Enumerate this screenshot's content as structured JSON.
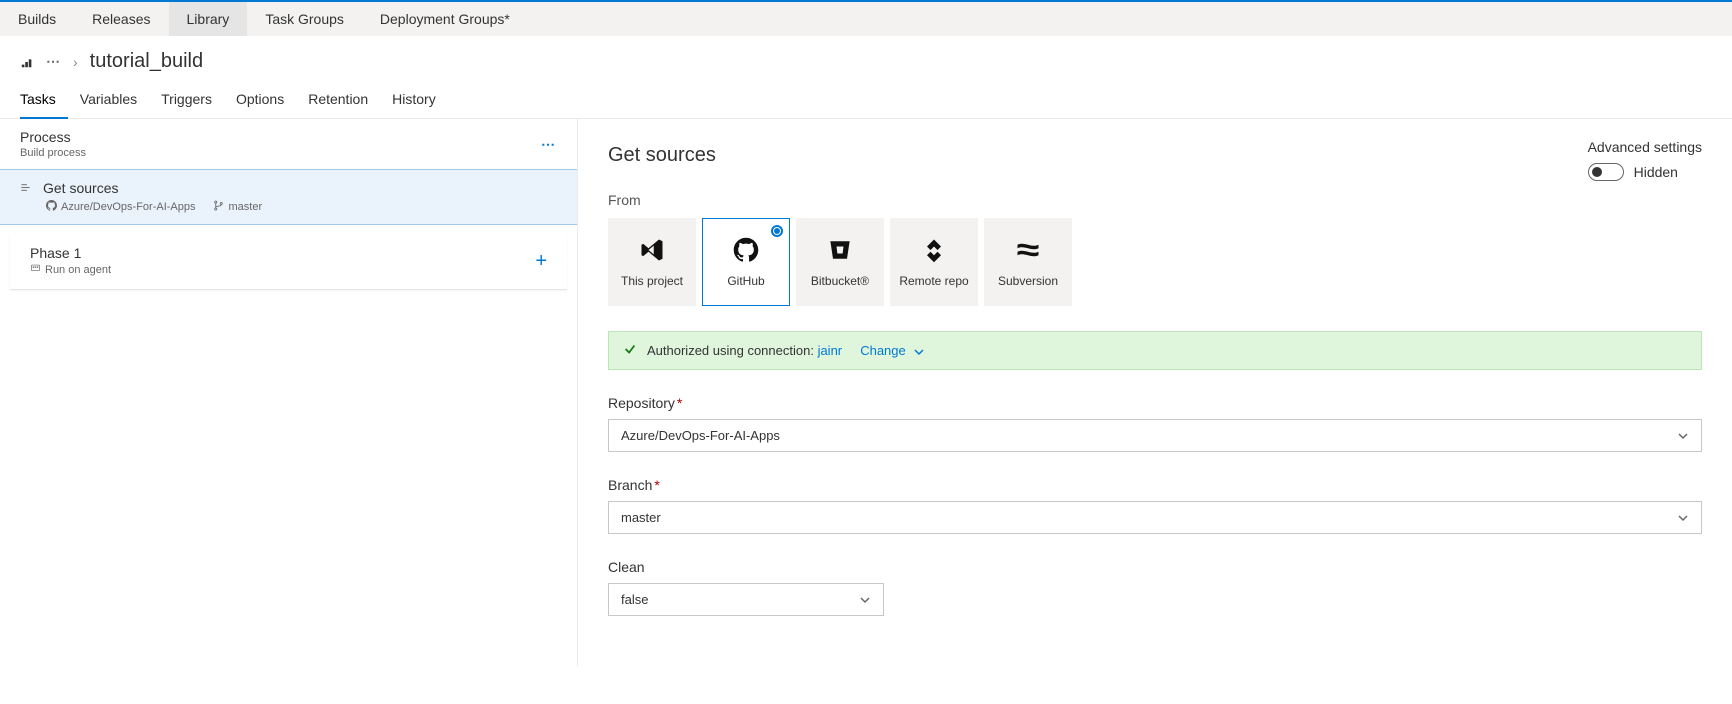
{
  "nav": {
    "items": [
      {
        "label": "Builds"
      },
      {
        "label": "Releases"
      },
      {
        "label": "Library"
      },
      {
        "label": "Task Groups"
      },
      {
        "label": "Deployment Groups*"
      }
    ]
  },
  "breadcrumb": {
    "title": "tutorial_build"
  },
  "tabs": {
    "items": [
      {
        "label": "Tasks"
      },
      {
        "label": "Variables"
      },
      {
        "label": "Triggers"
      },
      {
        "label": "Options"
      },
      {
        "label": "Retention"
      },
      {
        "label": "History"
      }
    ]
  },
  "leftPane": {
    "process": {
      "title": "Process",
      "subtitle": "Build process"
    },
    "getSources": {
      "title": "Get sources",
      "repo": "Azure/DevOps-For-AI-Apps",
      "branch": "master"
    },
    "phase": {
      "title": "Phase 1",
      "subtitle": "Run on agent"
    }
  },
  "detail": {
    "title": "Get sources",
    "fromLabel": "From",
    "advanced": {
      "label": "Advanced settings",
      "toggleLabel": "Hidden"
    },
    "sources": [
      {
        "label": "This project"
      },
      {
        "label": "GitHub"
      },
      {
        "label": "Bitbucket®"
      },
      {
        "label": "Remote repo"
      },
      {
        "label": "Subversion"
      }
    ],
    "auth": {
      "text": "Authorized using connection: ",
      "connection": "jainr",
      "change": "Change"
    },
    "repository": {
      "label": "Repository",
      "value": "Azure/DevOps-For-AI-Apps"
    },
    "branch": {
      "label": "Branch",
      "value": "master"
    },
    "clean": {
      "label": "Clean",
      "value": "false"
    }
  }
}
